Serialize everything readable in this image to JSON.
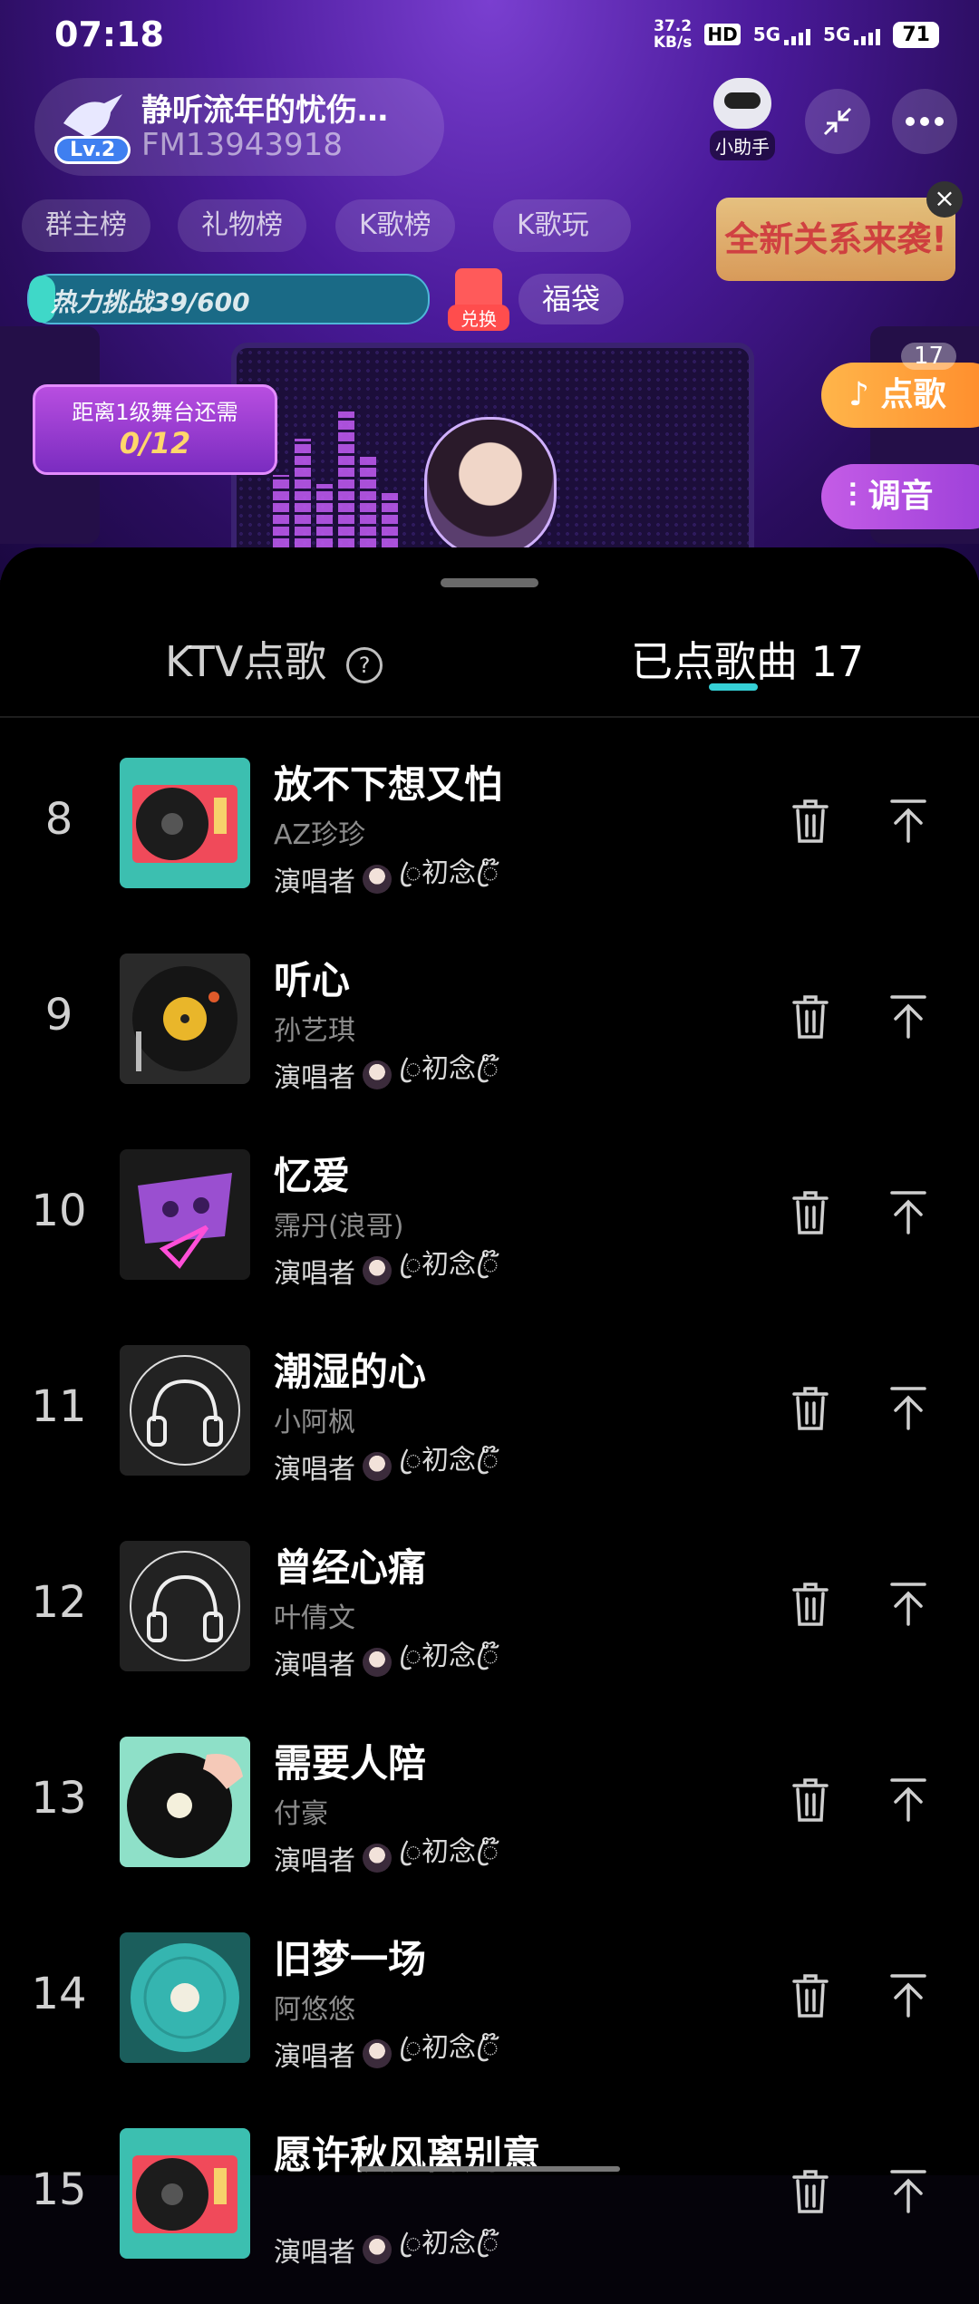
{
  "status_bar": {
    "time": "07:18",
    "net_speed_value": "37.2",
    "net_speed_unit": "KB/s",
    "hd_label": "HD",
    "sim1": "5G",
    "sim2": "5G",
    "battery": "71"
  },
  "room": {
    "title": "静听流年的忧伤…",
    "id": "FM13943918",
    "level": "Lv.2",
    "assistant_label": "小助手",
    "tags": [
      "群主榜",
      "礼物榜",
      "K歌榜",
      "K歌玩"
    ],
    "promo_text": "全新关系来袭!",
    "heat_challenge": "热力挑战39/600",
    "heat_progress": 0.065,
    "exchange_label": "兑换",
    "lucky_bag": "福袋",
    "stage_text": "距离1级舞台还需",
    "stage_count": "0/12",
    "song_btn": "点歌",
    "song_badge": "17",
    "tune_btn": "调音"
  },
  "sheet": {
    "tab_ktv": "KTV点歌",
    "tab_queued": "已点歌曲 17",
    "active_tab": "tab_queued",
    "accent_color": "#35d0d6",
    "singer_prefix": "演唱者",
    "singer_name": "ꦿ初念ꦿ໊",
    "songs": [
      {
        "rank": "8",
        "title": "放不下想又怕",
        "artist": "AZ珍珍",
        "cover": "turntable-icon"
      },
      {
        "rank": "9",
        "title": "听心",
        "artist": "孙艺琪",
        "cover": "vinyl-space-icon"
      },
      {
        "rank": "10",
        "title": "忆爱",
        "artist": "霈丹(浪哥)",
        "cover": "cassette-icon"
      },
      {
        "rank": "11",
        "title": "潮湿的心",
        "artist": "小阿枫",
        "cover": "headphones-icon"
      },
      {
        "rank": "12",
        "title": "曾经心痛",
        "artist": "叶倩文",
        "cover": "headphones-icon"
      },
      {
        "rank": "13",
        "title": "需要人陪",
        "artist": "付豪",
        "cover": "record-hand-icon"
      },
      {
        "rank": "14",
        "title": "旧梦一场",
        "artist": "阿悠悠",
        "cover": "teal-record-icon"
      },
      {
        "rank": "15",
        "title": "愿许秋风离别意",
        "artist": "",
        "cover": "turntable-icon"
      }
    ]
  }
}
